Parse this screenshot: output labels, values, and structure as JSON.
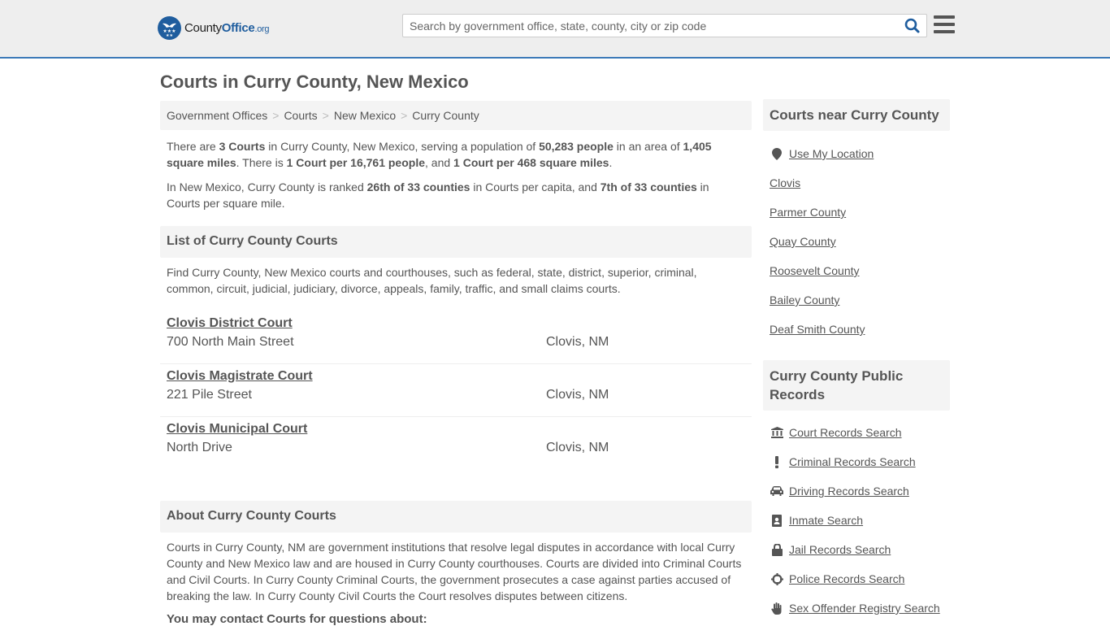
{
  "header": {
    "logo": {
      "name_part1": "County",
      "name_part2": "Office",
      "tld": ".org"
    },
    "search": {
      "placeholder": "Search by government office, state, county, city or zip code",
      "value": ""
    },
    "colors": {
      "brand": "#1f5d9e",
      "accent_border": "#3d7ab8",
      "topbar_bg": "#eeeeee"
    }
  },
  "page": {
    "title": "Courts in Curry County, New Mexico",
    "breadcrumb": [
      "Government Offices",
      "Courts",
      "New Mexico",
      "Curry County"
    ],
    "intro": {
      "p1": {
        "t1": "There are ",
        "b1": "3 Courts",
        "t2": " in Curry County, New Mexico, serving a population of ",
        "b2": "50,283 people",
        "t3": " in an area of ",
        "b3": "1,405 square miles",
        "t4": ". There is ",
        "b4": "1 Court per 16,761 people",
        "t5": ", and ",
        "b5": "1 Court per 468 square miles",
        "t6": "."
      },
      "p2": {
        "t1": "In New Mexico, Curry County is ranked ",
        "b1": "26th of 33 counties",
        "t2": " in Courts per capita, and ",
        "b2": "7th of 33 counties",
        "t3": " in Courts per square mile."
      }
    },
    "list_section": {
      "heading": "List of Curry County Courts",
      "description": "Find Curry County, New Mexico courts and courthouses, such as federal, state, district, superior, criminal, common, circuit, judicial, judiciary, divorce, appeals, family, traffic, and small claims courts.",
      "courts": [
        {
          "name": "Clovis District Court",
          "address": "700 North Main Street",
          "city": "Clovis, NM"
        },
        {
          "name": "Clovis Magistrate Court",
          "address": "221 Pile Street",
          "city": "Clovis, NM"
        },
        {
          "name": "Clovis Municipal Court",
          "address": "North Drive",
          "city": "Clovis, NM"
        }
      ]
    },
    "about_section": {
      "heading": "About Curry County Courts",
      "text": "Courts in Curry County, NM are government institutions that resolve legal disputes in accordance with local Curry County and New Mexico law and are housed in Curry County courthouses. Courts are divided into Criminal Courts and Civil Courts. In Curry County Criminal Courts, the government prosecutes a case against parties accused of breaking the law. In Curry County Civil Courts the Court resolves disputes between citizens.",
      "contact_label": "You may contact Courts for questions about:"
    }
  },
  "sidebar": {
    "nearby": {
      "heading": "Courts near Curry County",
      "use_location": {
        "label": "Use My Location",
        "icon": "map-marker-icon"
      },
      "items": [
        "Clovis",
        "Parmer County",
        "Quay County",
        "Roosevelt County",
        "Bailey County",
        "Deaf Smith County"
      ]
    },
    "records": {
      "heading": "Curry County Public Records",
      "items": [
        {
          "label": "Court Records Search",
          "icon": "courthouse-icon"
        },
        {
          "label": "Criminal Records Search",
          "icon": "exclamation-icon"
        },
        {
          "label": "Driving Records Search",
          "icon": "car-icon"
        },
        {
          "label": "Inmate Search",
          "icon": "id-badge-icon"
        },
        {
          "label": "Jail Records Search",
          "icon": "lock-icon"
        },
        {
          "label": "Police Records Search",
          "icon": "crosshairs-icon"
        },
        {
          "label": "Sex Offender Registry Search",
          "icon": "hand-icon"
        }
      ]
    }
  }
}
